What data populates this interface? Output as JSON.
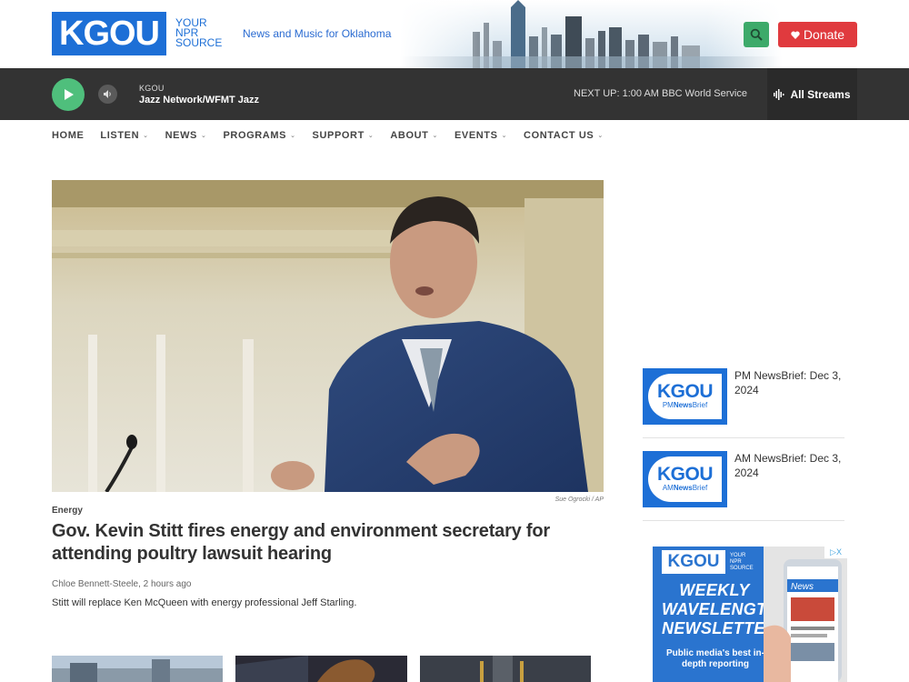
{
  "header": {
    "logo_text": "KGOU",
    "logo_sub": [
      "YOUR",
      "NPR",
      "SOURCE"
    ],
    "tagline": "News and Music for Oklahoma",
    "search_icon": "search-icon",
    "donate_label": "Donate",
    "donate_icon": "heart-icon"
  },
  "player": {
    "station_call": "KGOU",
    "station_stream": "Jazz Network/WFMT Jazz",
    "next_up": "NEXT UP: 1:00 AM BBC World Service",
    "streams_label": "All Streams"
  },
  "nav": {
    "items": [
      {
        "label": "HOME",
        "caret": false
      },
      {
        "label": "LISTEN",
        "caret": true
      },
      {
        "label": "NEWS",
        "caret": true
      },
      {
        "label": "PROGRAMS",
        "caret": true
      },
      {
        "label": "SUPPORT",
        "caret": true
      },
      {
        "label": "ABOUT",
        "caret": true
      },
      {
        "label": "EVENTS",
        "caret": true
      },
      {
        "label": "CONTACT US",
        "caret": true
      }
    ]
  },
  "hero": {
    "photo_credit": "Sue Ogrocki / AP",
    "category": "Energy",
    "headline": "Gov. Kevin Stitt fires energy and environment secretary for attending poultry lawsuit hearing",
    "byline": "Chloe Bennett-Steele, 2 hours ago",
    "teaser": "Stitt will replace Ken McQueen with energy professional Jeff Starling."
  },
  "sidebar": {
    "newsbriefs": [
      {
        "logo_big": "KGOU",
        "logo_prefix": "PM",
        "logo_suffix": "News",
        "logo_end": "Brief",
        "title": "PM NewsBrief: Dec 3, 2024"
      },
      {
        "logo_big": "KGOU",
        "logo_prefix": "AM",
        "logo_suffix": "News",
        "logo_end": "Brief",
        "title": "AM NewsBrief: Dec 3, 2024"
      }
    ],
    "ad": {
      "logo": "KGOU",
      "logo_sub": [
        "YOUR",
        "NPR",
        "SOURCE"
      ],
      "headline": "WEEKLY WAVELENGTHS NEWSLETTER",
      "copy": "Public media's best in-depth reporting",
      "phone_label": "News",
      "choices": "▷X"
    }
  },
  "colors": {
    "brand_blue": "#1d6fd6",
    "donate_red": "#e03a3e",
    "play_green": "#4fbf7c",
    "player_bg": "#333333"
  }
}
